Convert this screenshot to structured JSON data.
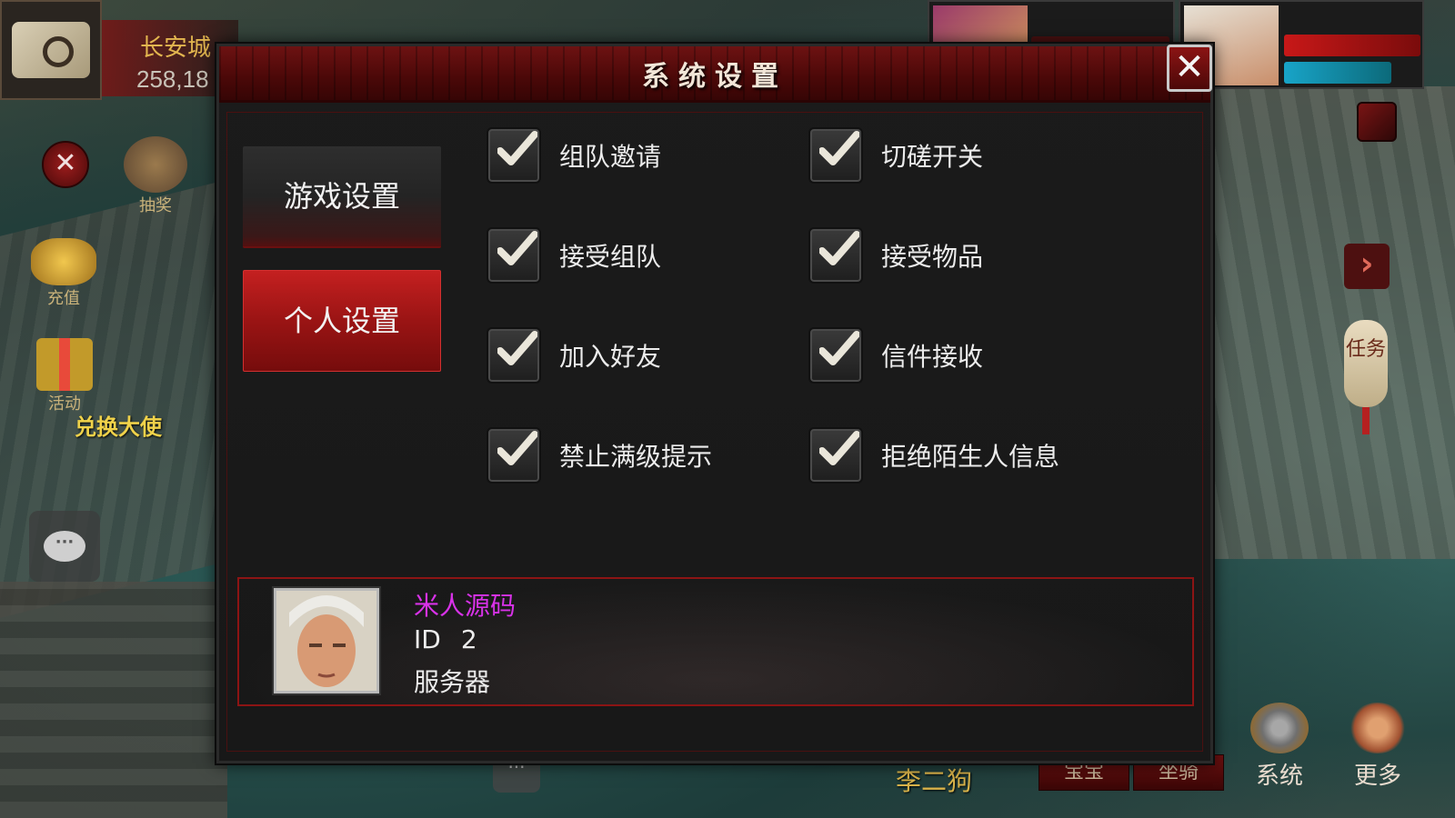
{
  "hud": {
    "location_name": "长安城",
    "coordinates": "258,18",
    "lottery_label": "抽奖",
    "recharge_label": "充值",
    "activity_label": "活动",
    "exchange_envoy": "兑换大使",
    "task_label": "任务",
    "player_name": "李二狗",
    "bottom_buttons": [
      "宝宝",
      "坐骑"
    ],
    "system_label": "系统",
    "more_label": "更多"
  },
  "dialog": {
    "title": "系统设置",
    "close_symbol": "✕",
    "tabs": [
      {
        "label": "游戏设置",
        "active": false
      },
      {
        "label": "个人设置",
        "active": true
      }
    ],
    "options": [
      {
        "label": "组队邀请",
        "checked": true
      },
      {
        "label": "切磋开关",
        "checked": true
      },
      {
        "label": "接受组队",
        "checked": true
      },
      {
        "label": "接受物品",
        "checked": true
      },
      {
        "label": "加入好友",
        "checked": true
      },
      {
        "label": "信件接收",
        "checked": true
      },
      {
        "label": "禁止满级提示",
        "checked": true
      },
      {
        "label": "拒绝陌生人信息",
        "checked": true
      }
    ],
    "profile": {
      "name": "米人源码",
      "id_label": "ID",
      "id_value": "2",
      "server_label": "服务器"
    }
  },
  "colors": {
    "accent_red": "#9a1414",
    "profile_name": "#d832e8",
    "gold_text": "#e3b64f"
  },
  "icons": [
    "scroll-map-icon",
    "close-icon",
    "lottery-scroll-icon",
    "coins-icon",
    "gift-box-icon",
    "chat-bubble-icon",
    "check-icon",
    "gear-icon",
    "cross-swords-icon",
    "chevron-right-icon",
    "lantern-icon"
  ]
}
